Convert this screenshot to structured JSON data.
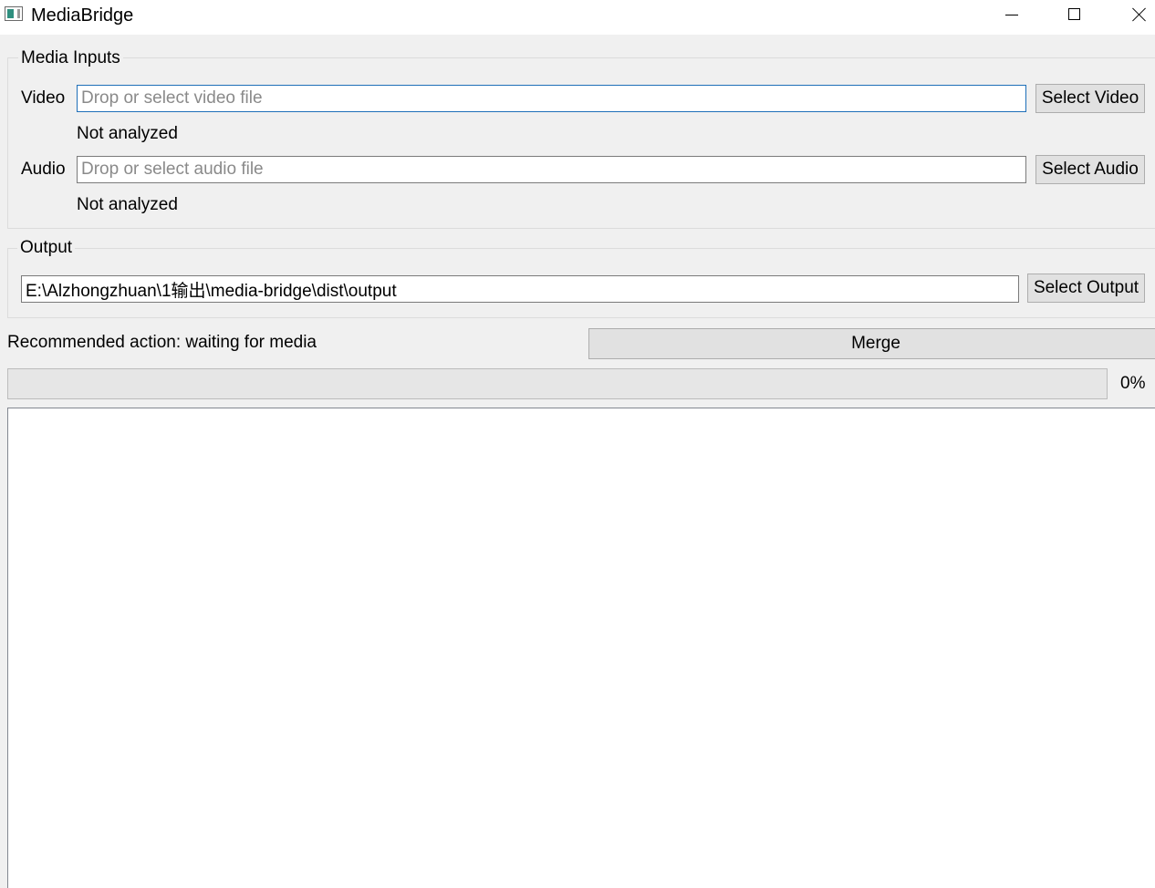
{
  "window": {
    "title": "MediaBridge"
  },
  "media_inputs": {
    "group_title": "Media Inputs",
    "video": {
      "label": "Video",
      "value": "",
      "placeholder": "Drop or select video file",
      "button": "Select Video",
      "status": "Not analyzed"
    },
    "audio": {
      "label": "Audio",
      "value": "",
      "placeholder": "Drop or select audio file",
      "button": "Select Audio",
      "status": "Not analyzed"
    }
  },
  "output": {
    "group_title": "Output",
    "path": "E:\\Alzhongzhuan\\1输出\\media-bridge\\dist\\output",
    "button": "Select Output"
  },
  "action": {
    "recommendation": "Recommended action: waiting for media",
    "merge_button": "Merge"
  },
  "progress": {
    "value": 0,
    "label": "0%"
  },
  "log": {
    "text": ""
  }
}
